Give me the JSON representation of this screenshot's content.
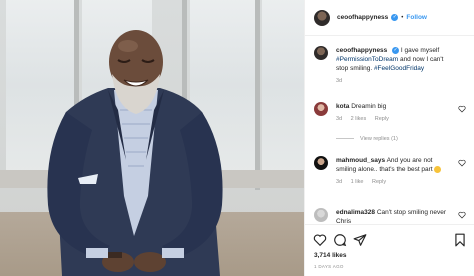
{
  "header": {
    "username": "ceoofhappyness",
    "follow_label": "Follow",
    "separator": "•"
  },
  "caption": {
    "username": "ceoofhappyness",
    "text_1": "I gave myself",
    "hashtag_1": "#PermissionToDream",
    "text_2": "and now I can't stop smiling.",
    "hashtag_2": "#FeelGoodFriday",
    "time": "3d"
  },
  "comments": [
    {
      "username": "kota",
      "text": "Dreamin big",
      "time": "3d",
      "likes": "2 likes",
      "reply": "Reply"
    },
    {
      "username": "mahmoud_says",
      "text": "And you are not smiling alone.. that's the best part",
      "time": "3d",
      "likes": "1 like",
      "reply": "Reply"
    },
    {
      "username": "ednalima328",
      "text": "Can't stop smiling never Chris"
    }
  ],
  "view_replies": "View replies (1)",
  "footer": {
    "likes": "3,714 likes",
    "posted": "1 DAYS AGO"
  },
  "icons": [
    "heart-icon",
    "comment-icon",
    "share-icon",
    "bookmark-icon",
    "verified-badge-icon"
  ],
  "colors": {
    "accent": "#3897f0",
    "hashtag": "#003569",
    "muted": "#8e8e8e",
    "text": "#262626"
  }
}
